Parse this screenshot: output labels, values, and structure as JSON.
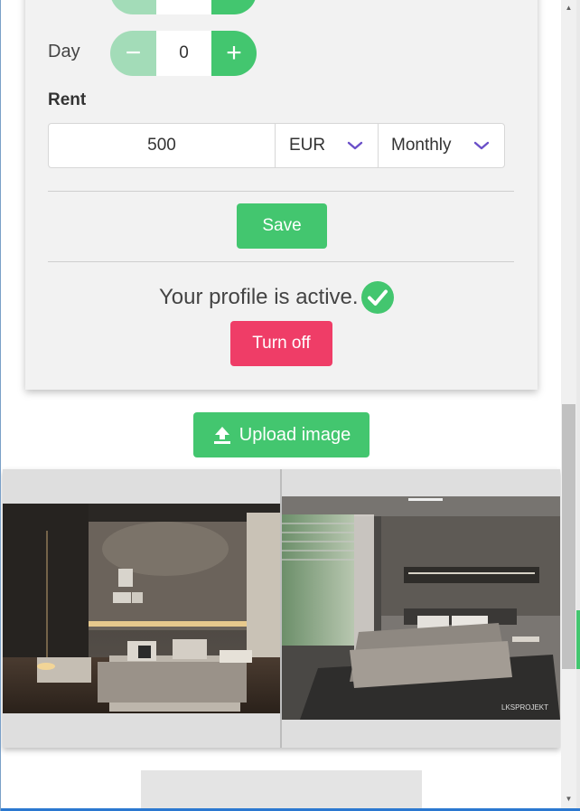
{
  "stepper_top": {
    "value": "",
    "minus": "−",
    "plus": "+"
  },
  "day": {
    "label": "Day",
    "value": "0",
    "minus": "−",
    "plus": "+"
  },
  "rent": {
    "label": "Rent",
    "amount": "500",
    "currency": "EUR",
    "period": "Monthly"
  },
  "save_label": "Save",
  "profile": {
    "status_text": "Your profile is active.",
    "turn_off_label": "Turn off"
  },
  "upload": {
    "label": "Upload image",
    "icon": "upload-icon"
  },
  "colors": {
    "green": "#43c66f",
    "green_light": "#a3dcb8",
    "red": "#ef3d67",
    "card_bg": "#f2f2f2",
    "chevron": "#6a4fc8"
  },
  "scrollbar": {
    "up_arrow": "▲",
    "down_arrow": "▼"
  }
}
